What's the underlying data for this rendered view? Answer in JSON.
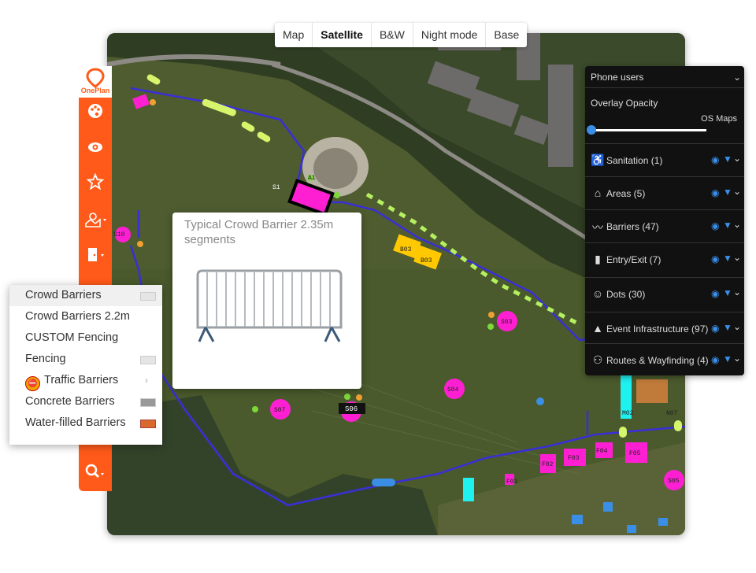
{
  "map_tabs": [
    {
      "label": "Map",
      "active": false
    },
    {
      "label": "Satellite",
      "active": true
    },
    {
      "label": "B&W",
      "active": false
    },
    {
      "label": "Night mode",
      "active": false
    },
    {
      "label": "Base",
      "active": false
    }
  ],
  "logo_text": "OnePlan",
  "toolbar": {
    "tools": [
      "palette-icon",
      "eye-icon",
      "star-icon",
      "map-pin-icon",
      "door-icon",
      "search-icon"
    ]
  },
  "menu": {
    "items": [
      {
        "label": "Crowd Barriers"
      },
      {
        "label": "Crowd Barriers 2.2m"
      },
      {
        "label": "CUSTOM Fencing"
      },
      {
        "label": "Fencing"
      },
      {
        "label": "Traffic Barriers"
      },
      {
        "label": "Concrete Barriers"
      },
      {
        "label": "Water-filled Barriers"
      }
    ]
  },
  "preview": {
    "title": "Typical Crowd Barrier 2.35m segments"
  },
  "panel": {
    "phone_users": "Phone users",
    "overlay_opacity": "Overlay Opacity",
    "os_maps": "OS Maps",
    "opacity_value": 0.02,
    "layers": [
      {
        "label": "Sanitation (1)",
        "icon": "toilet-icon"
      },
      {
        "label": "Areas (5)",
        "icon": "areas-icon"
      },
      {
        "label": "Barriers (47)",
        "icon": "barrier-icon"
      },
      {
        "label": "Entry/Exit (7)",
        "icon": "door-icon"
      },
      {
        "label": "Dots (30)",
        "icon": "person-icon"
      },
      {
        "label": "Event Infrastructure (97)",
        "icon": "shapes-icon"
      },
      {
        "label": "Routes & Wayfinding (4)",
        "icon": "people-icon"
      }
    ]
  },
  "map_labels": {
    "b03a": "B03",
    "b03b": "B03",
    "s03": "S03",
    "s04": "S04",
    "s06": "S06",
    "s07": "S07",
    "s10": "S10",
    "f02": "F02",
    "f03": "F03",
    "f04": "F04",
    "f05": "F05",
    "f01": "F01",
    "s05": "S05",
    "m02": "M02",
    "n07": "N07",
    "a1": "A1",
    "s1": "S1"
  },
  "colors": {
    "brand_orange": "#ff5a19",
    "route_blue": "#3a2fd6",
    "magenta": "#ff1fd3",
    "yellow": "#ffc800",
    "grass": "#4a5a2a"
  }
}
